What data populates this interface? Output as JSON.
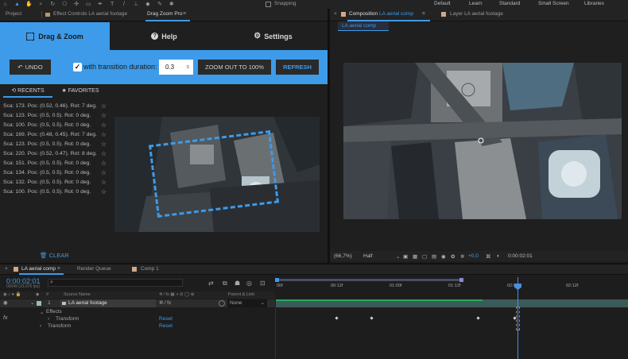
{
  "toolbar": {
    "workspaces": [
      "Default",
      "Learn",
      "Standard",
      "Small Screen",
      "Libraries"
    ],
    "snapping_label": "Snapping"
  },
  "left_panel_tabs": {
    "project": "Project",
    "effect_controls": "Effect Controls LA aerial footage",
    "drag_zoom_pro": "Drag Zoom Pro"
  },
  "plugin": {
    "tabs": [
      "Drag & Zoom",
      "Help",
      "Settings"
    ],
    "undo_label": "UNDO",
    "transition_checkbox_label": "with transition duration:",
    "duration_value": "0.3",
    "duration_unit": "s",
    "zoom_out_label": "ZOOM OUT TO 100%",
    "refresh_label": "REFRESH",
    "recents_tab": "RECENTS",
    "favorites_tab": "FAVORITES",
    "clear_label": "CLEAR",
    "recents": [
      "Sca: 173. Pos: (0.52, 0.46). Rot: 7 deg.",
      "Sca: 123. Pos: (0.5, 0.5). Rot: 0 deg.",
      "Sca: 100. Pos: (0.5, 0.5). Rot: 0 deg.",
      "Sca: 169. Pos: (0.48, 0.45). Rot: 7 deg.",
      "Sca: 123. Pos: (0.5, 0.5). Rot: 0 deg.",
      "Sca: 220. Pos: (0.52, 0.47). Rot: 8 deg.",
      "Sca: 151. Pos: (0.5, 0.5). Rot: 0 deg.",
      "Sca: 134. Pos: (0.5, 0.5). Rot: 0 deg.",
      "Sca: 132. Pos: (0.5, 0.5). Rot: 0 deg.",
      "Sca: 100. Pos: (0.5, 0.5). Rot: 0 deg."
    ]
  },
  "composition": {
    "tab_label": "Composition",
    "comp_name": "LA aerial comp",
    "layer_tab": "Layer LA aerial footage",
    "breadcrumb": "LA aerial comp",
    "zoom": "(66,7%)",
    "resolution": "Half",
    "exposure": "+0,0",
    "timecode": "0:00:02:01"
  },
  "timeline": {
    "tabs": [
      "LA aerial comp",
      "Render Queue",
      "Comp 1"
    ],
    "current_time": "0:00:02:01",
    "fps_info": "00049 (23.976 fps)",
    "columns": {
      "num": "#",
      "source": "Source Name",
      "parent": "Parent & Link"
    },
    "layer": {
      "index": "1",
      "name": "LA aerial footage",
      "parent": "None"
    },
    "effects_label": "Effects",
    "transform_rows": [
      {
        "label": "Transform",
        "reset": "Reset"
      },
      {
        "label": "Transform",
        "reset": "Reset"
      }
    ],
    "ruler_labels": [
      "00f",
      "00:12f",
      "01:00f",
      "01:12f",
      "02:00f",
      "02:12f"
    ]
  },
  "colors": {
    "accent_blue": "#3d9be9",
    "playhead": "#4a8fe0",
    "layer_bar": "#3b5a5a",
    "work_area": "#4a4a6a"
  }
}
